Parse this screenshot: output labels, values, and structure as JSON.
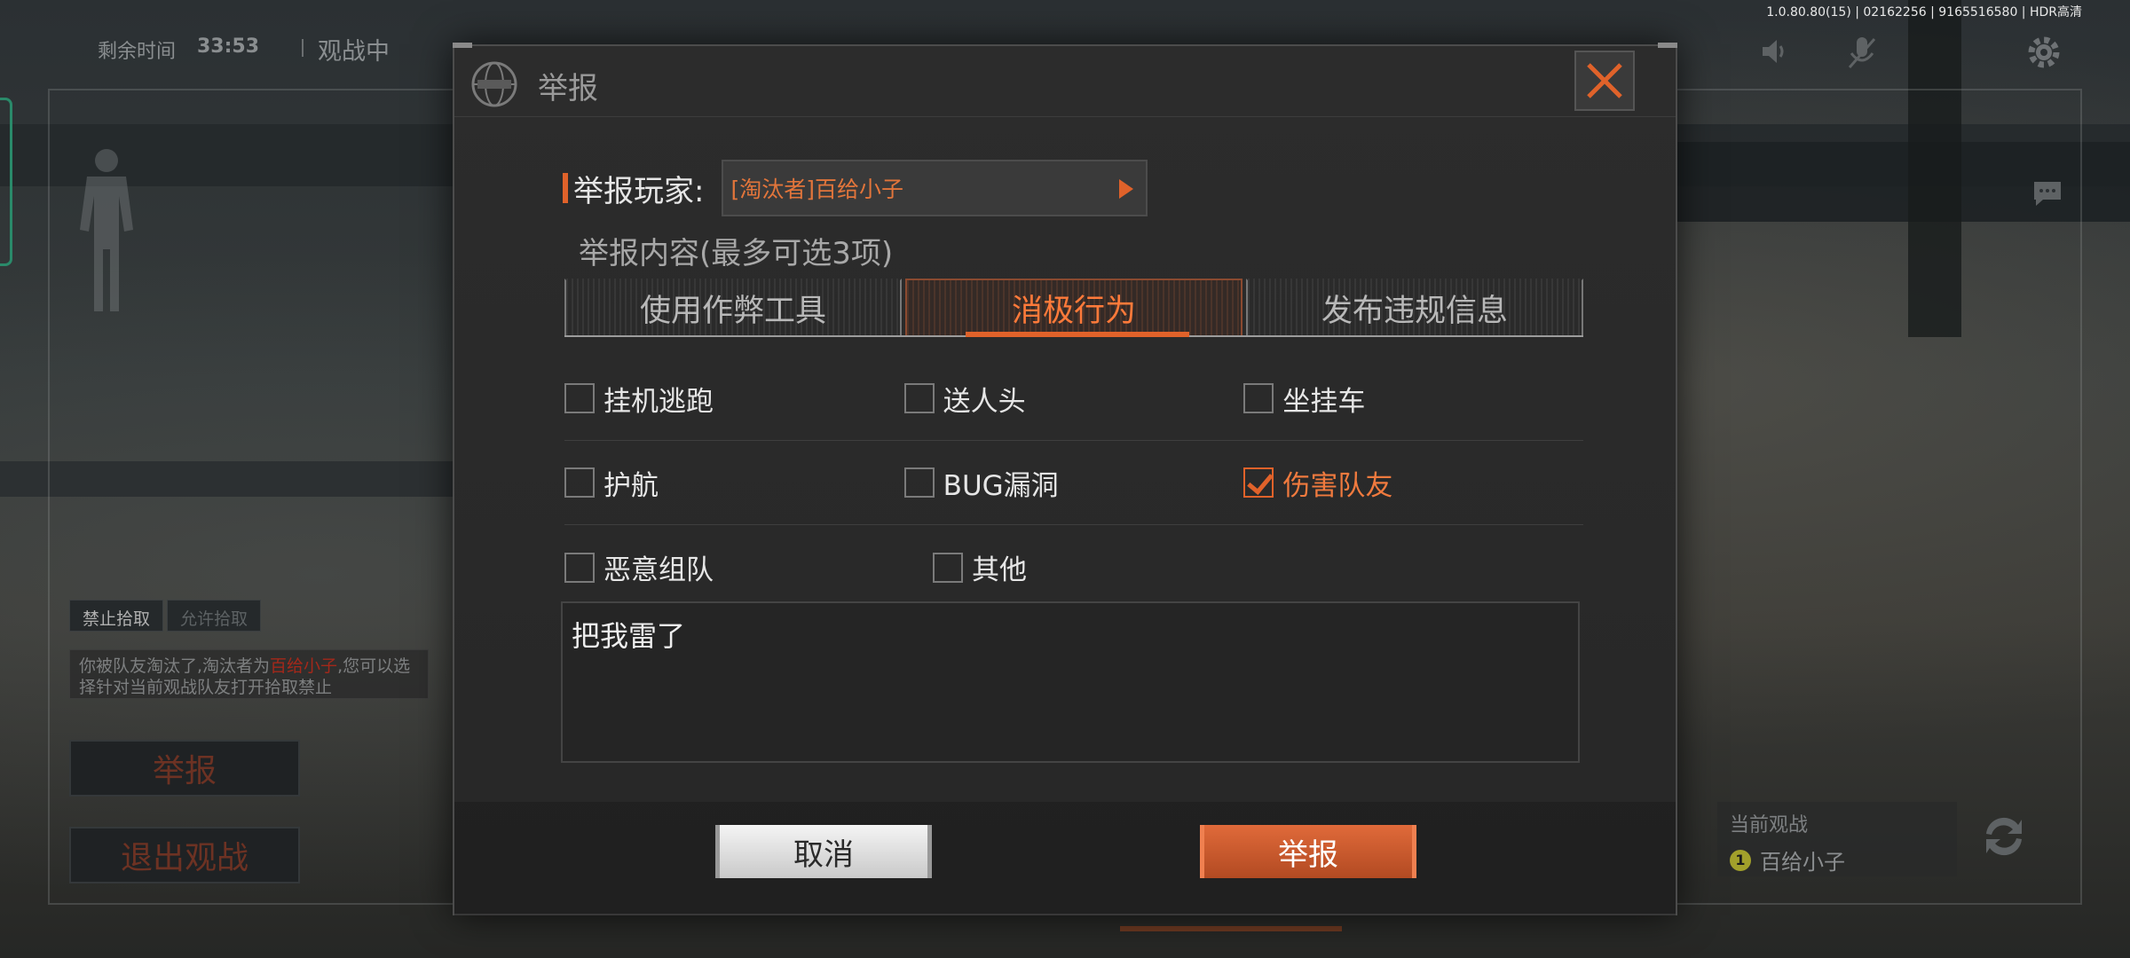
{
  "hud": {
    "time_label": "剩余时间",
    "time_value": "33:53",
    "spectating": "观战中",
    "version": "1.0.80.80(15) | 02162256 | 9165516580 | HDR高清"
  },
  "left_panel": {
    "pickup_tabs": [
      "禁止拾取",
      "允许拾取"
    ],
    "pickup_note_pre": "你被队友淘汰了,淘汰者为",
    "pickup_note_name": "百给小子",
    "pickup_note_post": ",您可以选择针对当前观战队友打开拾取禁止",
    "report_button": "举报",
    "exit_button": "退出观战"
  },
  "current_watch": {
    "label": "当前观战",
    "badge": "1",
    "name": "百给小子"
  },
  "modal": {
    "title": "举报",
    "player_label": "举报玩家:",
    "player_value": "[淘汰者]百给小子",
    "content_label": "举报内容(最多可选3项)",
    "tabs": [
      {
        "label": "使用作弊工具",
        "active": false
      },
      {
        "label": "消极行为",
        "active": true
      },
      {
        "label": "发布违规信息",
        "active": false
      }
    ],
    "options": [
      [
        {
          "label": "挂机逃跑",
          "checked": false
        },
        {
          "label": "送人头",
          "checked": false
        },
        {
          "label": "坐挂车",
          "checked": false
        }
      ],
      [
        {
          "label": "护航",
          "checked": false
        },
        {
          "label": "BUG漏洞",
          "checked": false
        },
        {
          "label": "伤害队友",
          "checked": true
        }
      ],
      [
        {
          "label": "恶意组队",
          "checked": false
        },
        {
          "label": "其他",
          "checked": false
        }
      ]
    ],
    "reason_text": "把我雷了",
    "cancel_button": "取消",
    "report_button": "举报"
  },
  "colors": {
    "accent": "#e0622a",
    "modal_bg": "#2a2a2a",
    "checked_text": "#f07a3e"
  },
  "icons": [
    "globe-icon",
    "close-icon",
    "speaker-icon",
    "mic-off-icon",
    "gear-icon",
    "chat-icon",
    "switch-camera-icon"
  ]
}
